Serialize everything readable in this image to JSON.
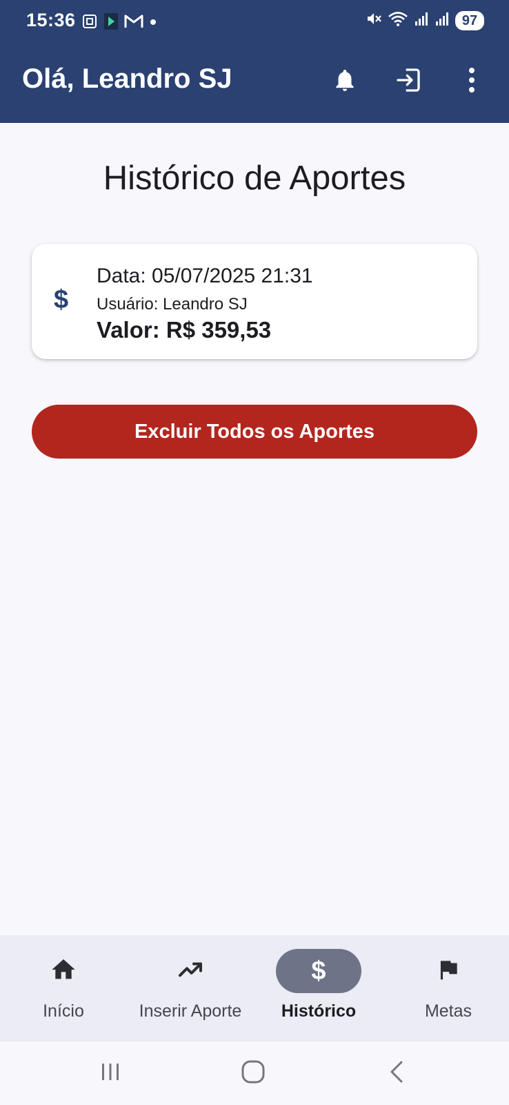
{
  "status_bar": {
    "time": "15:36",
    "battery": "97",
    "left_icons": [
      "screenshot-icon",
      "app-notification-icon",
      "gmail-icon",
      "dot-icon"
    ],
    "right_icons": [
      "mute-icon",
      "wifi-icon",
      "signal-icon",
      "signal-icon"
    ]
  },
  "app_bar": {
    "title": "Olá, Leandro SJ",
    "actions": [
      "bell-icon",
      "logout-icon",
      "more-vert-icon"
    ]
  },
  "page": {
    "title": "Histórico de Aportes"
  },
  "aportes": [
    {
      "icon": "dollar-icon",
      "icon_glyph": "$",
      "date": "Data: 05/07/2025 21:31",
      "user": "Usuário: Leandro SJ",
      "value": "Valor: R$ 359,53"
    }
  ],
  "delete_button": {
    "label": "Excluir Todos os Aportes"
  },
  "bottom_nav": {
    "items": [
      {
        "label": "Início",
        "icon": "home-icon",
        "active": false
      },
      {
        "label": "Inserir Aporte",
        "icon": "trending-up-icon",
        "active": false
      },
      {
        "label": "Histórico",
        "icon": "dollar-icon",
        "active": true
      },
      {
        "label": "Metas",
        "icon": "flag-icon",
        "active": false
      }
    ]
  },
  "colors": {
    "primary": "#2a4171",
    "danger": "#b3261e",
    "background": "#f7f7fc",
    "nav_background": "#ececf4",
    "nav_active_indicator": "#6e7488"
  }
}
